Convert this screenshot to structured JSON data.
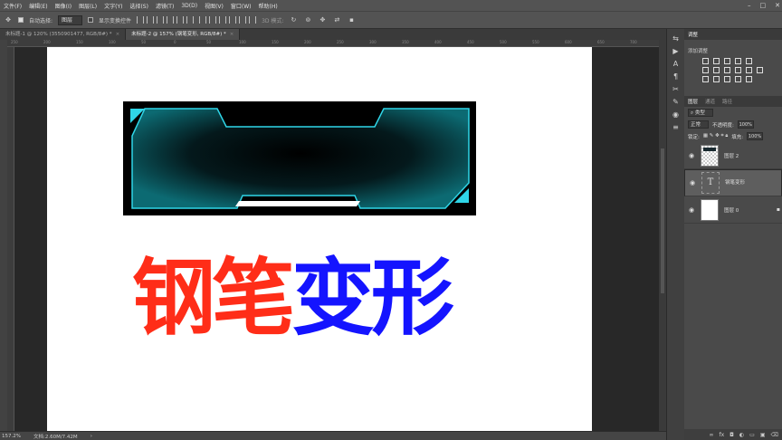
{
  "menu": [
    "文件(F)",
    "编辑(E)",
    "图像(I)",
    "图层(L)",
    "文字(Y)",
    "选择(S)",
    "滤镜(T)",
    "3D(D)",
    "视图(V)",
    "窗口(W)",
    "帮助(H)"
  ],
  "window_controls": {
    "minimize": "–",
    "maximize": "□",
    "close": "✕"
  },
  "options": {
    "auto_select_label": "自动选择:",
    "auto_select_value": "图层",
    "show_transform_label": "显示变换控件",
    "mode_3d_label": "3D 模式:"
  },
  "tabs": [
    {
      "label": "未标题-1 @ 120% (3550901477, RGB/8#) *",
      "active": false,
      "close": "×"
    },
    {
      "label": "未标题-2 @ 157% (钢笔变形, RGB/8#) *",
      "active": true,
      "close": "×"
    }
  ],
  "ruler_ticks": [
    "250",
    "200",
    "150",
    "100",
    "50",
    "0",
    "50",
    "100",
    "150",
    "200",
    "250",
    "300",
    "350",
    "400",
    "450",
    "500",
    "550",
    "600",
    "650",
    "700"
  ],
  "canvas": {
    "title_part1": "钢笔",
    "title_part2": "变形",
    "color_red": "#ff2d18",
    "color_blue": "#1414ff",
    "frame_glow": "#2fd6e8"
  },
  "status": {
    "zoom": "157.2%",
    "doc": "文档:2.60M/7.42M",
    "arrow": "›"
  },
  "panel_strip_icons": [
    "tool-presets-icon",
    "play-icon",
    "char-icon",
    "para-icon",
    "tools-icon",
    "brush-icon",
    "clone-icon",
    "adjust-icon"
  ],
  "adjustments": {
    "tab_label": "调整",
    "add_label": "添加调整"
  },
  "layers_panel": {
    "tabs": [
      "图层",
      "通道",
      "路径"
    ],
    "kind_label": "类型",
    "blend_mode": "正常",
    "opacity_label": "不透明度:",
    "opacity_value": "100%",
    "lock_label": "锁定:",
    "fill_label": "填充:",
    "fill_value": "100%",
    "layers": [
      {
        "name": "图层 2",
        "type": "image",
        "selected": false,
        "locked": false
      },
      {
        "name": "钢笔变形",
        "type": "text",
        "selected": true,
        "locked": false
      },
      {
        "name": "图层 0",
        "type": "white",
        "selected": false,
        "locked": true
      }
    ],
    "footer_icons": [
      "link-icon",
      "fx-icon",
      "mask-icon",
      "adjustment-icon",
      "group-icon",
      "new-layer-icon",
      "trash-icon"
    ]
  }
}
